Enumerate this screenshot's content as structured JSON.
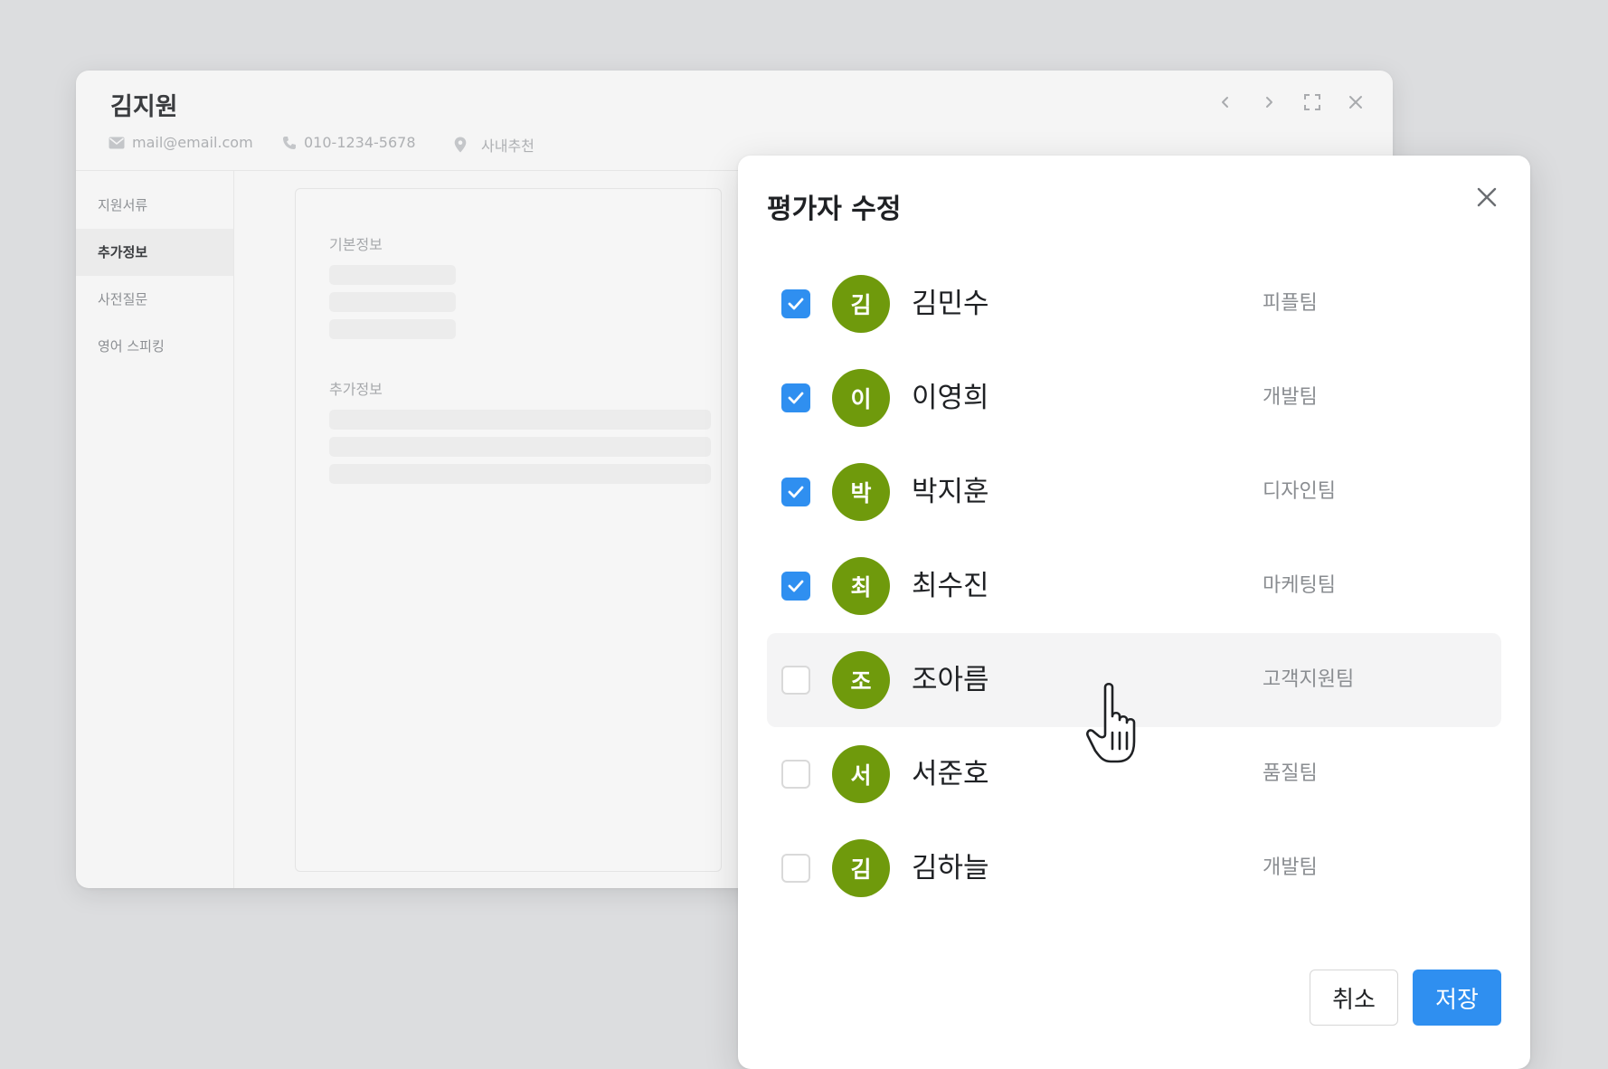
{
  "candidate": {
    "name": "김지원",
    "email": "mail@email.com",
    "phone": "010-1234-5678",
    "source": "사내추천"
  },
  "window_controls": [
    "chevron-left-icon",
    "chevron-right-icon",
    "expand-icon",
    "close-icon"
  ],
  "sidebar": {
    "items": [
      {
        "label": "지원서류",
        "active": false
      },
      {
        "label": "추가정보",
        "active": true
      },
      {
        "label": "사전질문",
        "active": false
      },
      {
        "label": "영어 스피킹",
        "active": false
      }
    ]
  },
  "content": {
    "sections": [
      "기본정보",
      "추가정보"
    ]
  },
  "modal": {
    "title": "평가자 수정",
    "evaluators": [
      {
        "initial": "김",
        "name": "김민수",
        "team": "피플팀",
        "checked": true
      },
      {
        "initial": "이",
        "name": "이영희",
        "team": "개발팀",
        "checked": true
      },
      {
        "initial": "박",
        "name": "박지훈",
        "team": "디자인팀",
        "checked": true
      },
      {
        "initial": "최",
        "name": "최수진",
        "team": "마케팅팀",
        "checked": true
      },
      {
        "initial": "조",
        "name": "조아름",
        "team": "고객지원팀",
        "checked": false
      },
      {
        "initial": "서",
        "name": "서준호",
        "team": "품질팀",
        "checked": false
      },
      {
        "initial": "김",
        "name": "김하늘",
        "team": "개발팀",
        "checked": false
      }
    ],
    "cancel_label": "취소",
    "save_label": "저장"
  },
  "colors": {
    "accent": "#2f8ff0",
    "avatar": "#6f9a0c",
    "backdrop": "#dcdddf"
  }
}
